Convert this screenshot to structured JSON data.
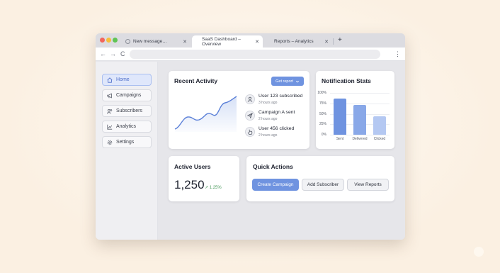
{
  "tabs": [
    {
      "label": "New message…",
      "active": false
    },
    {
      "label": "SaaS Dashboard – Overview",
      "active": true
    },
    {
      "label": "Reports – Analytics",
      "active": false
    }
  ],
  "tab_close": "✕",
  "new_tab": "+",
  "nav_buttons": {
    "back": "←",
    "forward": "→",
    "reload": "C",
    "menu": "⋮"
  },
  "sidebar": {
    "items": [
      {
        "label": "Home",
        "icon": "home-icon",
        "active": true
      },
      {
        "label": "Campaigns",
        "icon": "megaphone-icon",
        "active": false
      },
      {
        "label": "Subscribers",
        "icon": "users-icon",
        "active": false
      },
      {
        "label": "Analytics",
        "icon": "chart-line-icon",
        "active": false
      },
      {
        "label": "Settings",
        "icon": "gear-icon",
        "active": false
      }
    ]
  },
  "recent_activity": {
    "title": "Recent Activity",
    "report_button": "Get report",
    "dropdown_icon": "chevron-down-icon",
    "items": [
      {
        "title": "User 123 subscribed",
        "time": "3 hours ago",
        "icon": "user-icon"
      },
      {
        "title": "Campaign A sent",
        "time": "2 hours ago",
        "icon": "send-icon"
      },
      {
        "title": "User 456 clicked",
        "time": "2 hours ago",
        "icon": "pointer-icon"
      }
    ]
  },
  "notification_stats": {
    "title": "Notification Stats"
  },
  "chart_data": {
    "type": "bar",
    "title": "Notification Stats",
    "categories": [
      "Sent",
      "Delivered",
      "Clicked"
    ],
    "values": [
      87,
      71,
      44
    ],
    "yticks": [
      "100%",
      "75%",
      "50%",
      "25%",
      "0%"
    ],
    "ylim": [
      0,
      100
    ],
    "grid": true,
    "colors": [
      "#6f93e0",
      "#89a8e8",
      "#b4c8f2"
    ]
  },
  "active_users": {
    "title": "Active Users",
    "value": "1,250",
    "change": "↗ 1.25%"
  },
  "quick_actions": {
    "title": "Quick Actions",
    "buttons": [
      "Create Campaign",
      "Add Subscriber",
      "View Reports"
    ]
  },
  "colors": {
    "accent": "#6f93e0",
    "background": "#fbf0e2",
    "positive": "#4a9a5c"
  }
}
